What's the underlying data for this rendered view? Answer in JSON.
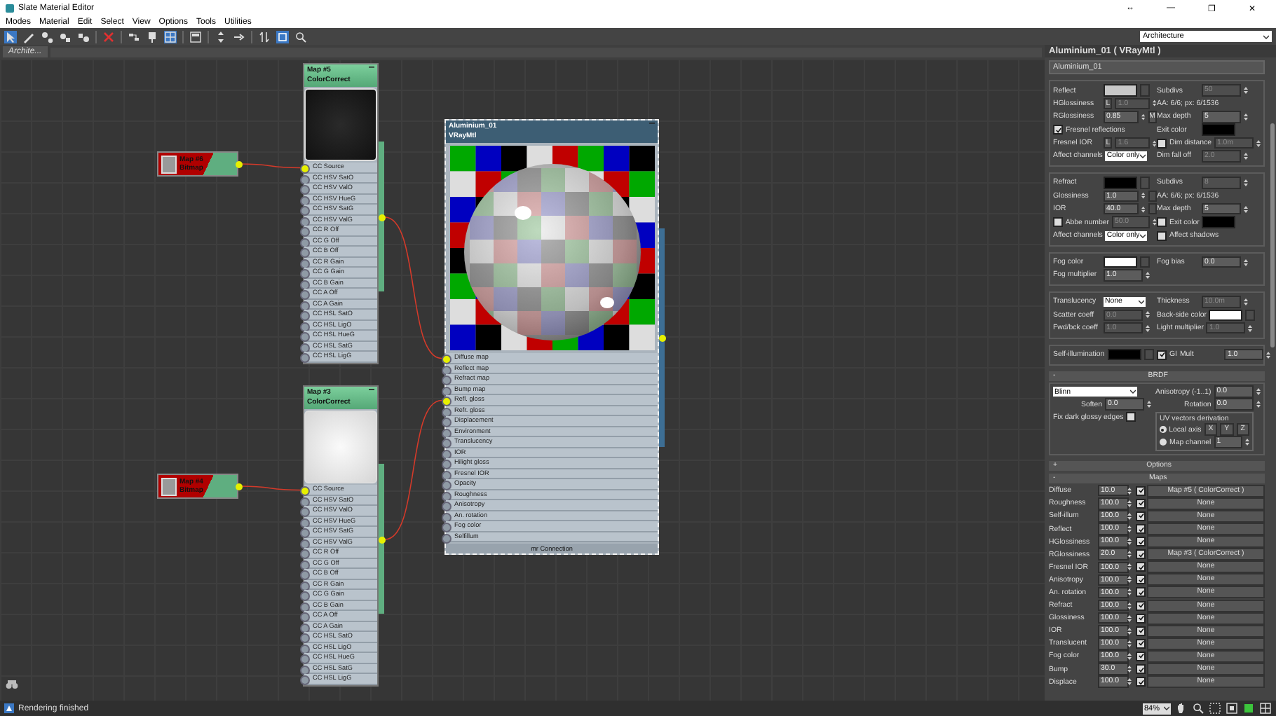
{
  "window": {
    "title": "Slate Material Editor",
    "controls": [
      "↔",
      "—",
      "❐",
      "✕"
    ]
  },
  "menu": [
    "Modes",
    "Material",
    "Edit",
    "Select",
    "View",
    "Options",
    "Tools",
    "Utilities"
  ],
  "toolbar": [
    {
      "selected": true
    },
    {
      "selected": false
    },
    {
      "selected": false
    },
    {
      "selected": false
    },
    {
      "selected": false
    },
    {
      "selected": false
    },
    {
      "selected": false
    },
    {
      "selected": false
    },
    {
      "selected": true
    },
    {
      "selected": false
    },
    {
      "selected": false
    },
    {
      "selected": false
    },
    {
      "selected": false
    },
    {
      "selected": true
    },
    {
      "selected": false
    }
  ],
  "view_dropdown": "Architecture",
  "view_tab": "Archite...",
  "canvas": {
    "nodes": [
      {
        "kind": "bitmap",
        "title": "Map #6",
        "subtitle": "Bitmap",
        "selected": false
      },
      {
        "kind": "map",
        "title": "Map #5",
        "subtitle": "ColorCorrect",
        "selected": false,
        "slots": [
          {
            "label": "CC Source",
            "connected": true
          },
          {
            "label": "CC HSV SatO",
            "connected": false
          },
          {
            "label": "CC HSV ValO",
            "connected": false
          },
          {
            "label": "CC HSV HueG",
            "connected": false
          },
          {
            "label": "CC HSV SatG",
            "connected": false
          },
          {
            "label": "CC HSV ValG",
            "connected": false
          },
          {
            "label": "CC R Off",
            "connected": false
          },
          {
            "label": "CC G Off",
            "connected": false
          },
          {
            "label": "CC B Off",
            "connected": false
          },
          {
            "label": "CC R Gain",
            "connected": false
          },
          {
            "label": "CC G Gain",
            "connected": false
          },
          {
            "label": "CC B Gain",
            "connected": false
          },
          {
            "label": "CC A Off",
            "connected": false
          },
          {
            "label": "CC A Gain",
            "connected": false
          },
          {
            "label": "CC HSL SatO",
            "connected": false
          },
          {
            "label": "CC HSL LigO",
            "connected": false
          },
          {
            "label": "CC HSL HueG",
            "connected": false
          },
          {
            "label": "CC HSL SatG",
            "connected": false
          },
          {
            "label": "CC HSL LigG",
            "connected": false
          }
        ]
      },
      {
        "kind": "bitmap",
        "title": "Map #4",
        "subtitle": "Bitmap",
        "selected": false
      },
      {
        "kind": "map",
        "title": "Map #3",
        "subtitle": "ColorCorrect",
        "selected": false,
        "slots": [
          {
            "label": "CC Source",
            "connected": true
          },
          {
            "label": "CC HSV SatO",
            "connected": false
          },
          {
            "label": "CC HSV ValO",
            "connected": false
          },
          {
            "label": "CC HSV HueG",
            "connected": false
          },
          {
            "label": "CC HSV SatG",
            "connected": false
          },
          {
            "label": "CC HSV ValG",
            "connected": false
          },
          {
            "label": "CC R Off",
            "connected": false
          },
          {
            "label": "CC G Off",
            "connected": false
          },
          {
            "label": "CC B Off",
            "connected": false
          },
          {
            "label": "CC R Gain",
            "connected": false
          },
          {
            "label": "CC G Gain",
            "connected": false
          },
          {
            "label": "CC B Gain",
            "connected": false
          },
          {
            "label": "CC A Off",
            "connected": false
          },
          {
            "label": "CC A Gain",
            "connected": false
          },
          {
            "label": "CC HSL SatO",
            "connected": false
          },
          {
            "label": "CC HSL LigO",
            "connected": false
          },
          {
            "label": "CC HSL HueG",
            "connected": false
          },
          {
            "label": "CC HSL SatG",
            "connected": false
          },
          {
            "label": "CC HSL LigG",
            "connected": false
          }
        ]
      },
      {
        "kind": "material",
        "title": "Aluminium_01",
        "subtitle": "VRayMtl",
        "selected": true,
        "footer": "mr Connection",
        "slots": [
          {
            "label": "Diffuse map",
            "connected": true
          },
          {
            "label": "Reflect map",
            "connected": false
          },
          {
            "label": "Refract map",
            "connected": false
          },
          {
            "label": "Bump map",
            "connected": false
          },
          {
            "label": "Refl. gloss",
            "connected": true
          },
          {
            "label": "Refr. gloss",
            "connected": false
          },
          {
            "label": "Displacement",
            "connected": false
          },
          {
            "label": "Environment",
            "connected": false
          },
          {
            "label": "Translucency",
            "connected": false
          },
          {
            "label": "IOR",
            "connected": false
          },
          {
            "label": "Hilight gloss",
            "connected": false
          },
          {
            "label": "Fresnel IOR",
            "connected": false
          },
          {
            "label": "Opacity",
            "connected": false
          },
          {
            "label": "Roughness",
            "connected": false
          },
          {
            "label": "Anisotropy",
            "connected": false
          },
          {
            "label": "An. rotation",
            "connected": false
          },
          {
            "label": "Fog color",
            "connected": false
          },
          {
            "label": "Selfillum",
            "connected": false
          }
        ]
      }
    ]
  },
  "panel": {
    "title": "Aluminium_01  ( VRayMtl )",
    "name": "Aluminium_01",
    "sections": [
      {
        "rows": [
          {
            "left": [
              {
                "kind": "label",
                "text": "Reflect"
              },
              {
                "kind": "swatch",
                "color": "#c8c8c8"
              },
              {
                "kind": "mapbutton"
              }
            ],
            "right": [
              {
                "kind": "label",
                "text": "Subdivs"
              },
              {
                "kind": "field",
                "value": "50",
                "disabled": true
              }
            ]
          },
          {
            "left": [
              {
                "kind": "label",
                "text": "HGlossiness"
              },
              {
                "kind": "button",
                "text": "L"
              },
              {
                "kind": "field",
                "value": "1.0",
                "disabled": true
              }
            ],
            "right": [
              {
                "kind": "note",
                "text": "AA: 6/6; px: 6/1536"
              }
            ]
          },
          {
            "left": [
              {
                "kind": "label",
                "text": "RGlossiness"
              },
              {
                "kind": "field",
                "value": "0.85",
                "disabled": false
              },
              {
                "kind": "button",
                "text": "M"
              }
            ],
            "right": [
              {
                "kind": "label",
                "text": "Max depth"
              },
              {
                "kind": "field",
                "value": "5",
                "disabled": false
              }
            ]
          },
          {
            "left": [
              {
                "kind": "checkbox",
                "text": "Fresnel reflections",
                "checked": true
              }
            ],
            "right": [
              {
                "kind": "label",
                "text": "Exit color"
              },
              {
                "kind": "swatch",
                "color": "#000000"
              }
            ]
          },
          {
            "left": [
              {
                "kind": "label",
                "text": "Fresnel IOR"
              },
              {
                "kind": "button",
                "text": "L"
              },
              {
                "kind": "field",
                "value": "1.6",
                "disabled": true
              }
            ],
            "right": [
              {
                "kind": "checkbox",
                "text": "Dim distance",
                "checked": false
              },
              {
                "kind": "field",
                "value": "1.0m",
                "disabled": true
              }
            ]
          },
          {
            "left": [
              {
                "kind": "label",
                "text": "Affect channels"
              },
              {
                "kind": "dropdown",
                "text": "Color only"
              }
            ],
            "right": [
              {
                "kind": "label",
                "text": "Dim fall off"
              },
              {
                "kind": "field",
                "value": "2.0",
                "disabled": true
              }
            ]
          }
        ]
      },
      {
        "rows": [
          {
            "left": [
              {
                "kind": "label",
                "text": "Refract"
              },
              {
                "kind": "swatch",
                "color": "#000000"
              },
              {
                "kind": "mapbutton"
              }
            ],
            "right": [
              {
                "kind": "label",
                "text": "Subdivs"
              },
              {
                "kind": "field",
                "value": "8",
                "disabled": true
              }
            ]
          },
          {
            "left": [
              {
                "kind": "label",
                "text": "Glossiness"
              },
              {
                "kind": "field",
                "value": "1.0",
                "disabled": false
              },
              {
                "kind": "mapbutton"
              }
            ],
            "right": [
              {
                "kind": "note",
                "text": "AA: 6/6; px: 6/1536"
              }
            ]
          },
          {
            "left": [
              {
                "kind": "label",
                "text": "IOR"
              },
              {
                "kind": "field",
                "value": "40.0",
                "disabled": false
              },
              {
                "kind": "mapbutton"
              }
            ],
            "right": [
              {
                "kind": "label",
                "text": "Max depth"
              },
              {
                "kind": "field",
                "value": "5",
                "disabled": false
              }
            ]
          },
          {
            "left": [
              {
                "kind": "checkbox",
                "text": "Abbe number",
                "checked": false
              },
              {
                "kind": "field",
                "value": "50.0",
                "disabled": true
              }
            ],
            "right": [
              {
                "kind": "checkbox",
                "text": "Exit color",
                "checked": false
              },
              {
                "kind": "swatch",
                "color": "#000000"
              }
            ]
          },
          {
            "left": [
              {
                "kind": "label",
                "text": "Affect channels"
              },
              {
                "kind": "dropdown",
                "text": "Color only"
              }
            ],
            "right": [
              {
                "kind": "checkbox",
                "text": "Affect shadows",
                "checked": false
              }
            ]
          }
        ]
      },
      {
        "rows": [
          {
            "left": [
              {
                "kind": "label",
                "text": "Fog color"
              },
              {
                "kind": "swatch",
                "color": "#ffffff"
              },
              {
                "kind": "mapbutton"
              }
            ],
            "right": [
              {
                "kind": "label",
                "text": "Fog bias"
              },
              {
                "kind": "field",
                "value": "0.0",
                "disabled": false
              }
            ]
          },
          {
            "left": [
              {
                "kind": "label",
                "text": "Fog multiplier"
              },
              {
                "kind": "field",
                "value": "1.0",
                "disabled": false
              }
            ],
            "right": []
          }
        ]
      },
      {
        "rows": [
          {
            "left": [
              {
                "kind": "label",
                "text": "Translucency"
              },
              {
                "kind": "dropdown",
                "text": "None"
              }
            ],
            "right": [
              {
                "kind": "label",
                "text": "Thickness"
              },
              {
                "kind": "field",
                "value": "10.0m",
                "disabled": true
              }
            ]
          },
          {
            "left": [
              {
                "kind": "label",
                "text": "Scatter coeff"
              },
              {
                "kind": "field",
                "value": "0.0",
                "disabled": true
              }
            ],
            "right": [
              {
                "kind": "label",
                "text": "Back-side color"
              },
              {
                "kind": "swatch",
                "color": "#ffffff"
              },
              {
                "kind": "mapbutton"
              }
            ]
          },
          {
            "left": [
              {
                "kind": "label",
                "text": "Fwd/bck coeff"
              },
              {
                "kind": "field",
                "value": "1.0",
                "disabled": true
              }
            ],
            "right": [
              {
                "kind": "label",
                "text": "Light multiplier"
              },
              {
                "kind": "field",
                "value": "1.0",
                "disabled": true
              }
            ]
          }
        ]
      },
      {
        "rows": [
          {
            "left": [
              {
                "kind": "label",
                "text": "Self-illumination"
              },
              {
                "kind": "swatch",
                "color": "#000000"
              },
              {
                "kind": "mapbutton"
              }
            ],
            "right": [
              {
                "kind": "checkbox",
                "text": "GI",
                "checked": true
              },
              {
                "kind": "label",
                "text": "Mult"
              },
              {
                "kind": "field",
                "value": "1.0",
                "disabled": false
              }
            ]
          }
        ]
      }
    ],
    "brdf": {
      "title": "BRDF",
      "collapse": "-",
      "type": "Blinn",
      "anisotropy_label": "Anisotropy (-1..1)",
      "anisotropy": "0.0",
      "rotation_label": "Rotation",
      "rotation": "0.0",
      "soften_label": "Soften",
      "soften": "0.0",
      "fix_label": "Fix dark glossy edges",
      "fix_checked": false,
      "uv_group": "UV vectors derivation",
      "local_axis": {
        "label": "Local axis",
        "selected": true
      },
      "axes": [
        "X",
        "Y",
        "Z"
      ],
      "map_channel": {
        "label": "Map channel",
        "selected": false,
        "value": "1"
      }
    },
    "options": {
      "title": "Options",
      "collapse": "+"
    },
    "maps": {
      "title": "Maps",
      "collapse": "-",
      "rows": [
        {
          "name": "Diffuse",
          "amount": "10.0",
          "enabled": true,
          "map": "Map #5  ( ColorCorrect )"
        },
        {
          "name": "Roughness",
          "amount": "100.0",
          "enabled": true,
          "map": "None"
        },
        {
          "name": "Self-illum",
          "amount": "100.0",
          "enabled": true,
          "map": "None"
        },
        {
          "name": "Reflect",
          "amount": "100.0",
          "enabled": true,
          "map": "None"
        },
        {
          "name": "HGlossiness",
          "amount": "100.0",
          "enabled": true,
          "map": "None"
        },
        {
          "name": "RGlossiness",
          "amount": "20.0",
          "enabled": true,
          "map": "Map #3  ( ColorCorrect )"
        },
        {
          "name": "Fresnel IOR",
          "amount": "100.0",
          "enabled": true,
          "map": "None"
        },
        {
          "name": "Anisotropy",
          "amount": "100.0",
          "enabled": true,
          "map": "None"
        },
        {
          "name": "An. rotation",
          "amount": "100.0",
          "enabled": true,
          "map": "None"
        },
        {
          "name": "Refract",
          "amount": "100.0",
          "enabled": true,
          "map": "None"
        },
        {
          "name": "Glossiness",
          "amount": "100.0",
          "enabled": true,
          "map": "None"
        },
        {
          "name": "IOR",
          "amount": "100.0",
          "enabled": true,
          "map": "None"
        },
        {
          "name": "Translucent",
          "amount": "100.0",
          "enabled": true,
          "map": "None"
        },
        {
          "name": "Fog color",
          "amount": "100.0",
          "enabled": true,
          "map": "None"
        },
        {
          "name": "Bump",
          "amount": "30.0",
          "enabled": true,
          "map": "None"
        },
        {
          "name": "Displace",
          "amount": "100.0",
          "enabled": true,
          "map": "None"
        }
      ]
    }
  },
  "status": {
    "text": "Rendering finished",
    "zoom": "84%"
  }
}
